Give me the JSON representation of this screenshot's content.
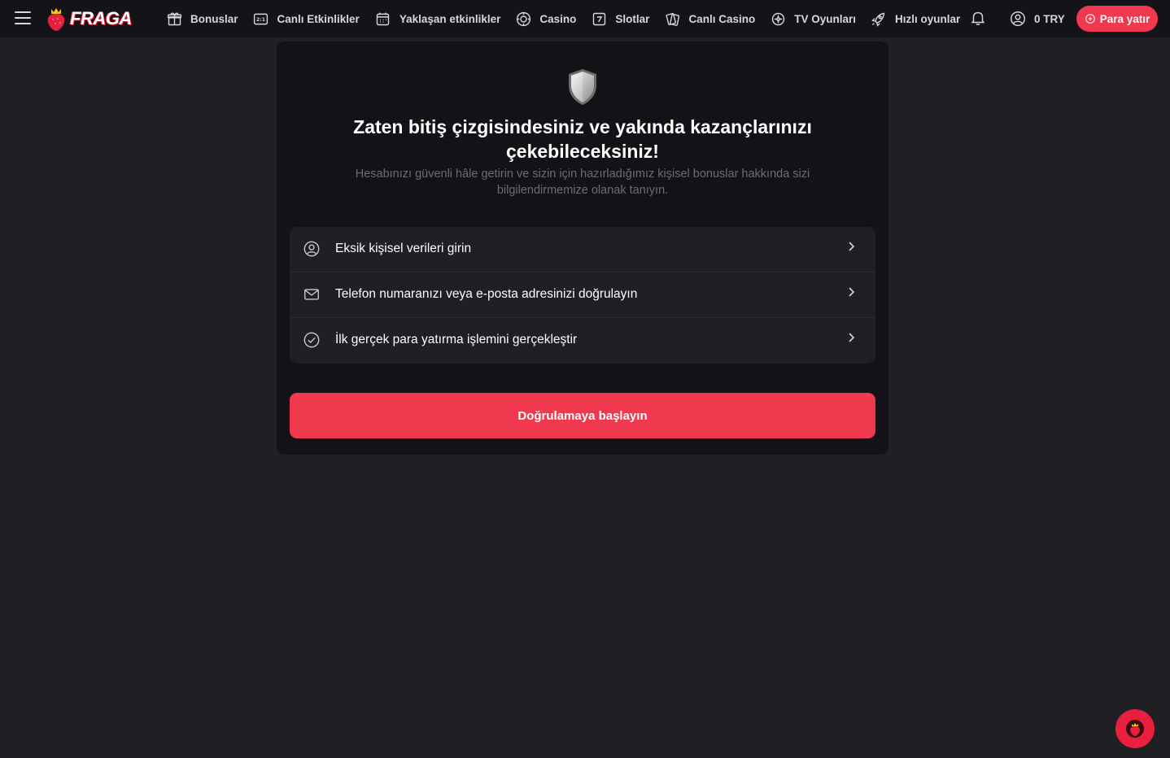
{
  "header": {
    "logo_text": "FRAGA",
    "nav": [
      {
        "label": "Bonuslar",
        "icon": "gift-icon"
      },
      {
        "label": "Canlı Etkinlikler",
        "icon": "live-score-icon"
      },
      {
        "label": "Yaklaşan etkinlikler",
        "icon": "calendar-icon"
      },
      {
        "label": "Casino",
        "icon": "casino-chip-icon"
      },
      {
        "label": "Slotlar",
        "icon": "slot-icon"
      },
      {
        "label": "Canlı Casino",
        "icon": "cards-icon"
      },
      {
        "label": "TV Oyunları",
        "icon": "tv-games-icon"
      },
      {
        "label": "Hızlı oyunlar",
        "icon": "rocket-icon"
      }
    ],
    "balance": "0 TRY",
    "deposit_label": "Para yatır"
  },
  "card": {
    "icon": "shield-icon",
    "title": "Zaten bitiş çizgisindesiniz ve yakında kazançlarınızı çekebileceksiniz!",
    "subtitle": "Hesabınızı güvenli hâle getirin ve sizin için hazırladığımız kişisel bonuslar hakkında sizi bilgilendirmemize olanak tanıyın.",
    "steps": [
      {
        "label": "Eksik kişisel verileri girin",
        "icon": "user-circle-icon"
      },
      {
        "label": "Telefon numaranızı veya e-posta adresinizi doğrulayın",
        "icon": "mail-icon"
      },
      {
        "label": "İlk gerçek para yatırma işlemini gerçekleştir",
        "icon": "check-circle-icon"
      }
    ],
    "cta_label": "Doğrulamaya başlayın"
  },
  "colors": {
    "accent": "#f0394f",
    "background": "#1f1f24",
    "card": "#131317",
    "topbar": "#141418"
  }
}
